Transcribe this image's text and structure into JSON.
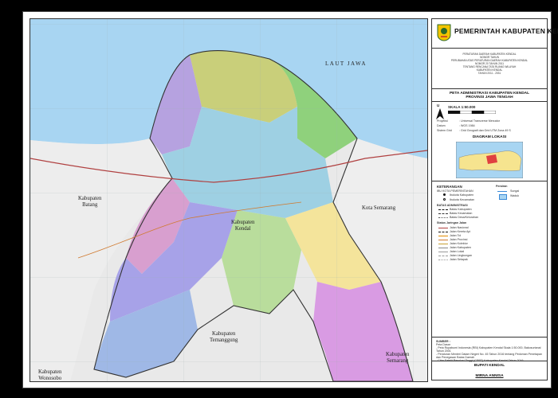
{
  "header": {
    "title": "PEMERINTAH KABUPATEN KENDAL",
    "regulation_lines": [
      "PERATURAN DAERAH KABUPATEN KENDAL",
      "NOMOR    TAHUN",
      "PERUBAHAN ATAS PERATURAN DAERAH KABUPATEN KENDAL",
      "NOMOR 20 TAHUN 2011",
      "TENTANG RENCANA TATA RUANG WILAYAH",
      "KABUPATEN KENDAL",
      "TAHUN 2011 - 2031"
    ]
  },
  "map_info": {
    "title_line1": "PETA ADMINISTRASI KABUPATEN KENDAL",
    "title_line2": "PROVINSI JAWA TENGAH",
    "north_label": "U",
    "scale_label": "SKALA  1:50.000",
    "projection_label": "Proyeksi",
    "projection_value": ": Universal Transverse Mercator",
    "datum_label": "Datum",
    "datum_value": ": WGS 1984",
    "grid_label": "Sistem Grid",
    "grid_value": ": Grid Geografi dan Grid UTM Zona 49 S",
    "location_diagram": "DIAGRAM LOKASI"
  },
  "legend": {
    "title": "KETERANGAN",
    "subtitle": "IBU KOTA PEMERINTAHAN",
    "admin_items": [
      "Ibukota Kabupaten",
      "Ibukota Kecamatan"
    ],
    "boundary_title": "BATAS ADMINISTRASI",
    "boundary_items": [
      "Batas Kabupaten",
      "Batas Kecamatan",
      "Batas Desa/Kelurahan"
    ],
    "road_title": "Status Jaringan Jalan",
    "road_items": [
      "Jalan Nasional",
      "Jalan Kereta Api",
      "Jalan Tol",
      "Jalan Provinsi",
      "Jalan Kolektor",
      "Jalan Kabupaten",
      "Jalan Lokal",
      "Jalan Lingkungan",
      "Jalan Setapak"
    ],
    "water_title": "Perairan",
    "water_items": [
      "Sungai",
      "Waduk"
    ]
  },
  "sources": {
    "title": "SUMBER :",
    "lines": [
      "Peta Dasar",
      "- Peta Rupabumi Indonesia (RBI) Kabupaten Kendal Skala 1:50.000, Bakosurtanal Tahun 2001",
      "- Peraturan Menteri Dalam Negeri No. 45 Tahun 2016 tentang Pedoman Penetapan dan Penegasan Batas Daerah",
      "- Citra Satelit Resolusi Tinggi (CSRT) Kabupaten Kendal Tahun 2016",
      "- Survei Lapangan dan Konsultasi Publik Kabupaten Kendal Tahun 2018"
    ]
  },
  "signature": {
    "office": "BUPATI KENDAL",
    "name": "MIRNA ANNISA"
  },
  "map_labels": {
    "sea": "LAUT  JAWA",
    "kab_batang": "Kabupaten\nBatang",
    "kota_semarang": "Kota Semarang",
    "kab_kendal": "Kabupaten\nKendal",
    "kab_temanggung": "Kabupaten\nTemanggung",
    "kab_semarang": "Kabupaten\nSemarang",
    "kab_wonosobo": "Kabupaten\nWonosobo"
  }
}
